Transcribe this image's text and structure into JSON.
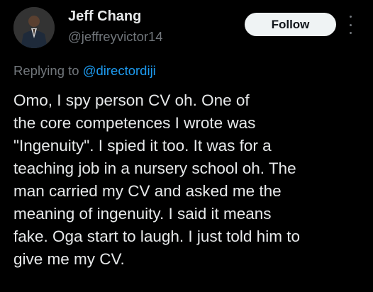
{
  "tweet": {
    "author": {
      "display_name": "Jeff Chang",
      "handle": "@jeffreyvictor14",
      "avatar_icon": "avatar-photo"
    },
    "follow_label": "Follow",
    "more_icon": "more-vertical-icon",
    "replying_prefix": "Replying to",
    "replying_to": "@directordiji",
    "body_lines": [
      "Omo, I spy person CV oh. One of",
      "the core competences I wrote was",
      "\"Ingenuity\". I spied it too. It was for a",
      "teaching job in a nursery school oh. The",
      "man carried my CV and asked me the",
      "meaning of ingenuity. I said it means",
      "fake. Oga start to laugh. I just told him to",
      "give me my CV."
    ]
  },
  "colors": {
    "background": "#000000",
    "text_primary": "#e7e9ea",
    "text_secondary": "#71767b",
    "link": "#1d9bf0",
    "follow_bg": "#eff3f4"
  }
}
